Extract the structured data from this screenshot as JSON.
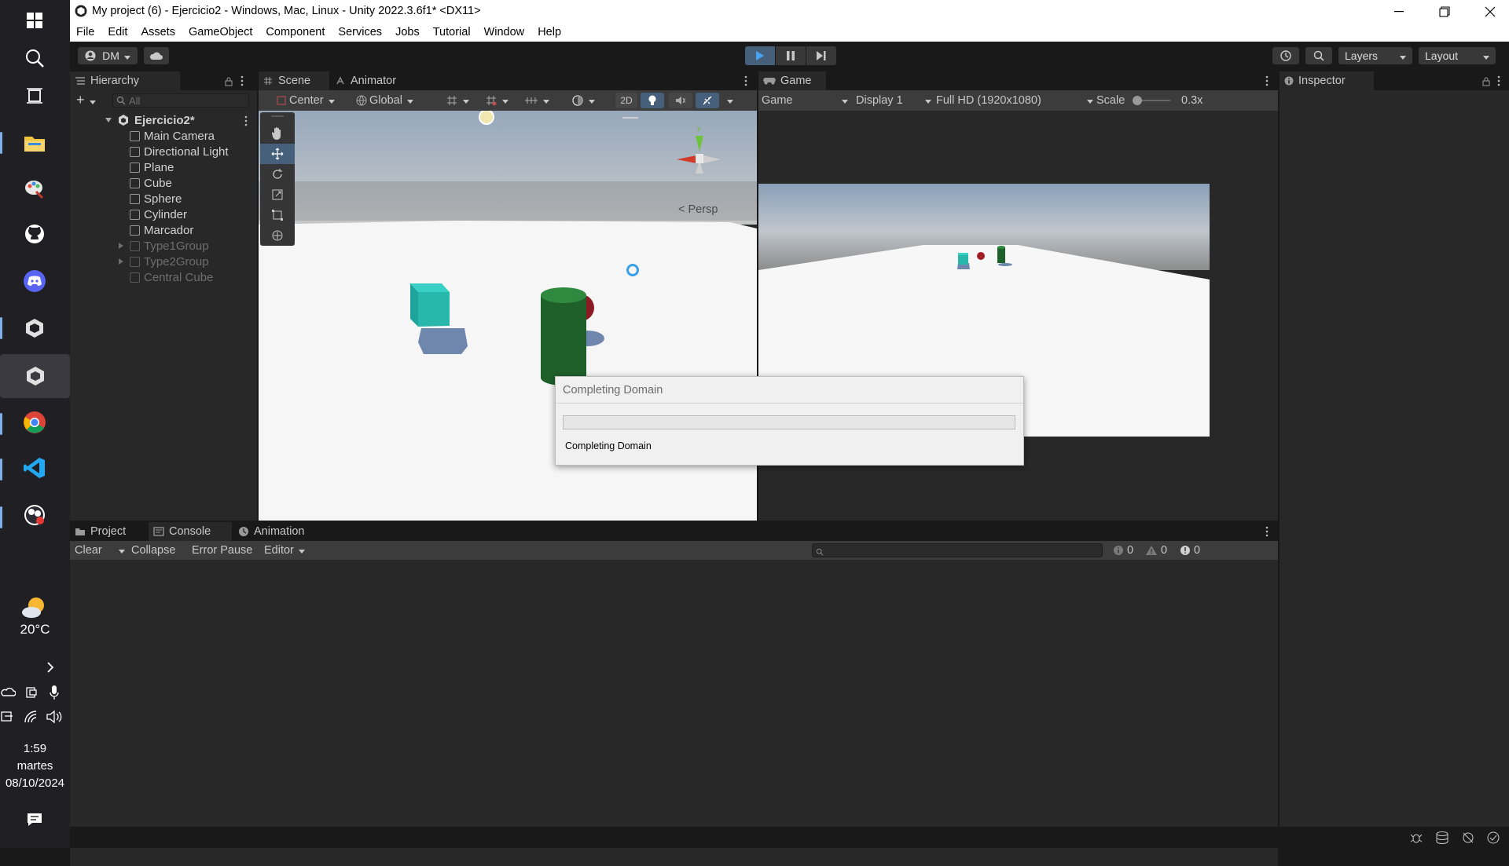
{
  "window": {
    "title": "My project (6) - Ejercicio2 - Windows, Mac, Linux - Unity 2022.3.6f1* <DX11>"
  },
  "menu": [
    "File",
    "Edit",
    "Assets",
    "GameObject",
    "Component",
    "Services",
    "Jobs",
    "Tutorial",
    "Window",
    "Help"
  ],
  "toolbar": {
    "account": "DM",
    "layers": "Layers",
    "layout": "Layout"
  },
  "hierarchy": {
    "tab": "Hierarchy",
    "search_placeholder": "All",
    "scene": "Ejercicio2*",
    "items": [
      {
        "label": "Main Camera",
        "active": true
      },
      {
        "label": "Directional Light",
        "active": true
      },
      {
        "label": "Plane",
        "active": true
      },
      {
        "label": "Cube",
        "active": true
      },
      {
        "label": "Sphere",
        "active": true
      },
      {
        "label": "Cylinder",
        "active": true
      },
      {
        "label": "Marcador",
        "active": true
      },
      {
        "label": "Type1Group",
        "active": false
      },
      {
        "label": "Type2Group",
        "active": false
      },
      {
        "label": "Central Cube",
        "active": false
      }
    ]
  },
  "scene_view": {
    "tabs": [
      "Scene",
      "Animator"
    ],
    "pivot": "Center",
    "space": "Global",
    "mode_2d": "2D",
    "persp": "Persp",
    "gizmo_axis": "y"
  },
  "game_view": {
    "tab": "Game",
    "mode": "Game",
    "display": "Display 1",
    "resolution": "Full HD (1920x1080)",
    "scale_label": "Scale",
    "scale_value": "0.3x"
  },
  "inspector": {
    "tab": "Inspector"
  },
  "bottom": {
    "tabs": [
      "Project",
      "Console",
      "Animation"
    ],
    "clear": "Clear",
    "collapse": "Collapse",
    "error_pause": "Error Pause",
    "editor": "Editor",
    "counts": {
      "log": "0",
      "warn": "0",
      "error": "0"
    }
  },
  "dialog": {
    "title": "Completing Domain",
    "message": "Completing Domain",
    "progress": 0
  },
  "taskbar": {
    "weather": "20°C",
    "time": "1:59",
    "day": "martes",
    "date": "08/10/2024"
  }
}
